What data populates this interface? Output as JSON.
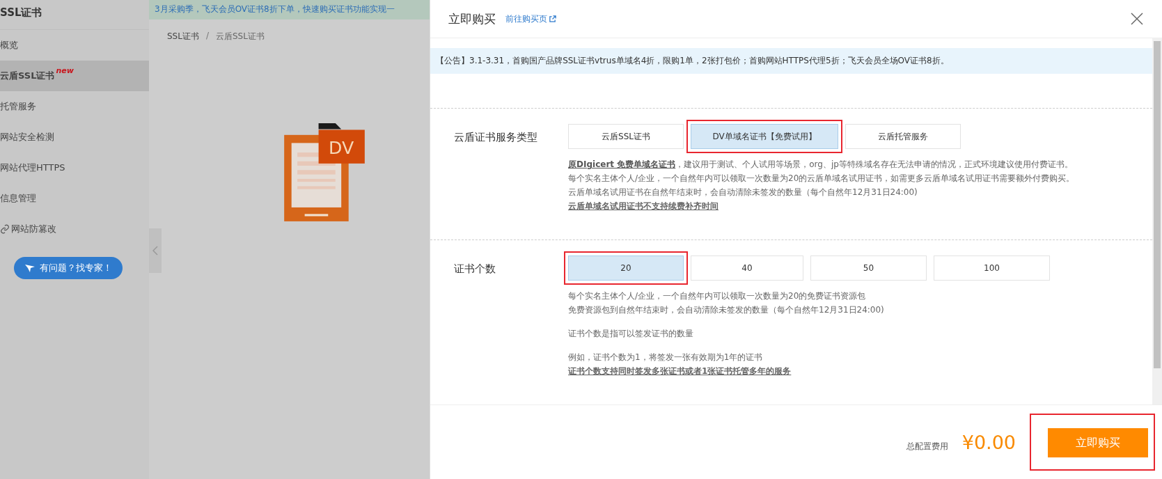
{
  "sidebar": {
    "title": "SSL证书",
    "items": [
      {
        "label": "概览",
        "selected": false,
        "kind": "plain"
      },
      {
        "label": "云盾SSL证书",
        "badge": "new",
        "selected": true,
        "kind": "plain"
      },
      {
        "label": "托管服务",
        "selected": false,
        "kind": "plain"
      },
      {
        "label": "网站安全检测",
        "selected": false,
        "kind": "plain"
      },
      {
        "label": "网站代理HTTPS",
        "selected": false,
        "kind": "plain"
      },
      {
        "label": "信息管理",
        "selected": false,
        "kind": "plain"
      },
      {
        "label": "网站防篡改",
        "selected": false,
        "kind": "link"
      }
    ],
    "help_button": "有问题？找专家！"
  },
  "banner": "3月采购季，飞天会员OV证书8折下单，快速购买证书功能实现一",
  "breadcrumb": [
    "SSL证书",
    "云盾SSL证书"
  ],
  "breadcrumb_separator": "/",
  "product_badge": "DV",
  "drawer": {
    "title": "立即购买",
    "link": "前往购买页",
    "notice": "【公告】3.1-3.31，首购国产品牌SSL证书vtrus单域名4折，限购1单，2张打包价；首购网站HTTPS代理5折；飞天会员全场OV证书8折。",
    "sections": [
      {
        "label": "云盾证书服务类型",
        "options": [
          {
            "label": "云盾SSL证书",
            "selected": false
          },
          {
            "label": "DV单域名证书【免费试用】",
            "selected": true
          },
          {
            "label": "云盾托管服务",
            "selected": false
          }
        ],
        "notes": [
          {
            "text": "**原DIgicert 免费单域名证书**，建议用于测试、个人试用等场景，org、jp等特殊域名存在无法申请的情况，正式环境建议使用付费证书。",
            "kind": "line"
          },
          {
            "text": "每个实名主体个人/企业，一个自然年内可以领取一次数量为20的云盾单域名试用证书，如需更多云盾单域名试用证书需要额外付费购买。",
            "kind": "line"
          },
          {
            "text": "云盾单域名试用证书在自然年结束时，会自动清除未签发的数量（每个自然年12月31日24:00)",
            "kind": "line"
          },
          {
            "text": "云盾单域名试用证书不支持续费补齐时间",
            "kind": "emphasis"
          }
        ]
      },
      {
        "label": "证书个数",
        "options": [
          {
            "label": "20",
            "selected": true
          },
          {
            "label": "40",
            "selected": false
          },
          {
            "label": "50",
            "selected": false
          },
          {
            "label": "100",
            "selected": false
          }
        ],
        "notes": [
          {
            "text": "每个实名主体个人/企业，一个自然年内可以领取一次数量为20的免费证书资源包",
            "kind": "line"
          },
          {
            "text": "免费资源包到自然年结束时，会自动清除未签发的数量（每个自然年12月31日24:00)",
            "kind": "line"
          },
          {
            "text": "证书个数是指可以签发证书的数量",
            "kind": "paragraph"
          },
          {
            "text": "例如，证书个数为1，将签发一张有效期为1年的证书",
            "kind": "paragraph"
          },
          {
            "text": "证书个数支持同时签发多张证书或者1张证书托管多年的服务",
            "kind": "emphasis"
          }
        ]
      }
    ],
    "total_label": "总配置费用",
    "total_price": "¥0.00",
    "buy_button": "立即购买"
  }
}
